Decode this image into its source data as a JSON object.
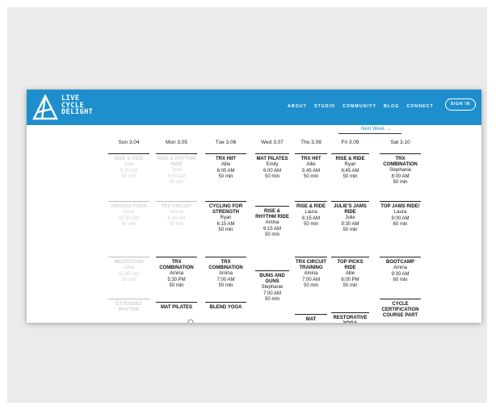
{
  "brand": {
    "line1": "LIVE",
    "line2": "CYCLE",
    "line3": "DELIGHT"
  },
  "nav": [
    "ABOUT",
    "STUDIO",
    "COMMUNITY",
    "BLOG",
    "CONNECT"
  ],
  "signin_label": "SIGN IN",
  "next_week_label": "Next Week →",
  "colors": {
    "header": "#1e8fcc",
    "accent": "#1e8fcc"
  },
  "days": [
    {
      "label": "Sun 3.04",
      "classes": [
        {
          "name": "RISE & RIDE",
          "lines": [
            "Julie",
            "9:15 AM",
            "50 min"
          ],
          "past": true
        },
        {
          "name": "VINYASA YOGA",
          "lines": [
            "Adria",
            "10:30 AM",
            "60 min"
          ],
          "past": true
        },
        {
          "name": "MEDITATION",
          "lines": [
            "Adria",
            "11:45 AM",
            "30 min"
          ],
          "past": true
        },
        {
          "name": "EXTENDED RHYTHM",
          "lines": [],
          "past": true
        }
      ]
    },
    {
      "label": "Mon 3.05",
      "classes": [
        {
          "name": "RISE & RHYTHM RIDE",
          "lines": [
            "Todd",
            "6:00 AM",
            "50 min"
          ],
          "past": true
        },
        {
          "name": "TRX CIRCUIT",
          "lines": [
            "Amina",
            "6:30 AM",
            "50 min"
          ],
          "past": true
        },
        {
          "name": "TRX COMBINATION",
          "lines": [
            "Amina",
            "5:30 PM",
            "50 min"
          ],
          "past": false
        },
        {
          "name": "MAT PILATES",
          "lines": [],
          "past": false
        }
      ]
    },
    {
      "label": "Tue 3.06",
      "classes": [
        {
          "name": "TRX HIIT",
          "lines": [
            "Allie",
            "6:00 AM",
            "50 min"
          ],
          "past": false
        },
        {
          "name": "CYCLING FOR STRENGTH",
          "lines": [
            "Ryan",
            "6:15 AM",
            "50 min"
          ],
          "past": false
        },
        {
          "name": "TRX COMBINATION",
          "lines": [
            "Amina",
            "7:00 AM",
            "50 min"
          ],
          "past": false
        },
        {
          "name": "BLEND YOGA",
          "lines": [],
          "past": false
        }
      ]
    },
    {
      "label": "Wed 3.07",
      "classes": [
        {
          "name": "MAT PILATES",
          "lines": [
            "Emily",
            "6:00 AM",
            "50 min"
          ],
          "past": false
        },
        {
          "name": "RISE & RHYTHM RIDE",
          "lines": [
            "Amina",
            "6:15 AM",
            "50 min"
          ],
          "past": false
        },
        {
          "name": "BUNS AND GUNS",
          "lines": [
            "Stephanie",
            "7:00 AM",
            "50 min"
          ],
          "past": false
        }
      ]
    },
    {
      "label": "Thu 3.08",
      "classes": [
        {
          "name": "TRX HIIT",
          "lines": [
            "Allie",
            "5:45 AM",
            "50 min"
          ],
          "past": false
        },
        {
          "name": "RISE & RIDE",
          "lines": [
            "Laura",
            "6:15 AM",
            "50 min"
          ],
          "past": false
        },
        {
          "name": "TRX CIRCUIT TRAINING",
          "lines": [
            "Amina",
            "7:00 AM",
            "50 min"
          ],
          "past": false
        },
        {
          "name": "MAT",
          "lines": [],
          "past": false
        }
      ]
    },
    {
      "label": "Fri 3.09",
      "classes": [
        {
          "name": "RISE & RIDE",
          "lines": [
            "Ryan",
            "6:45 AM",
            "50 min"
          ],
          "past": false
        },
        {
          "name": "JULIE'S JAMS RIDE",
          "lines": [
            "Julie",
            "9:30 AM",
            "50 min"
          ],
          "past": false
        },
        {
          "name": "TOP PICKS RIDE",
          "lines": [
            "Allie",
            "6:00 PM",
            "50 min"
          ],
          "past": false
        },
        {
          "name": "RESTORATIVE YOGA",
          "lines": [],
          "past": false
        }
      ]
    },
    {
      "label": "Sat 3.10",
      "classes": [
        {
          "name": "TRX COMBINATION",
          "lines": [
            "Stephanie",
            "8:00 AM",
            "50 min"
          ],
          "past": false
        },
        {
          "name": "TOP JAMS RIDE!",
          "lines": [
            "Laura",
            "9:00 AM",
            "60 min"
          ],
          "past": false
        },
        {
          "name": "BOOTCAMP",
          "lines": [
            "Amina",
            "9:30 AM",
            "60 min"
          ],
          "past": false
        },
        {
          "name": "CYCLE CERTIFICATION COURSE PART",
          "lines": [],
          "past": false
        }
      ]
    }
  ]
}
